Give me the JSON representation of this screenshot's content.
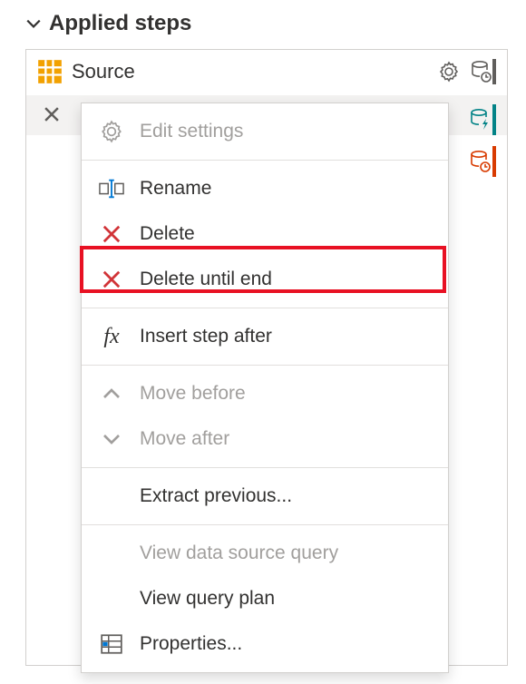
{
  "panel": {
    "title": "Applied steps"
  },
  "steps": {
    "source": "Source"
  },
  "menu": {
    "edit_settings": "Edit settings",
    "rename": "Rename",
    "delete": "Delete",
    "delete_until_end": "Delete until end",
    "insert_step_after": "Insert step after",
    "move_before": "Move before",
    "move_after": "Move after",
    "extract_previous": "Extract previous...",
    "view_data_source_query": "View data source query",
    "view_query_plan": "View query plan",
    "properties": "Properties..."
  },
  "highlighted_item": "delete_until_end"
}
